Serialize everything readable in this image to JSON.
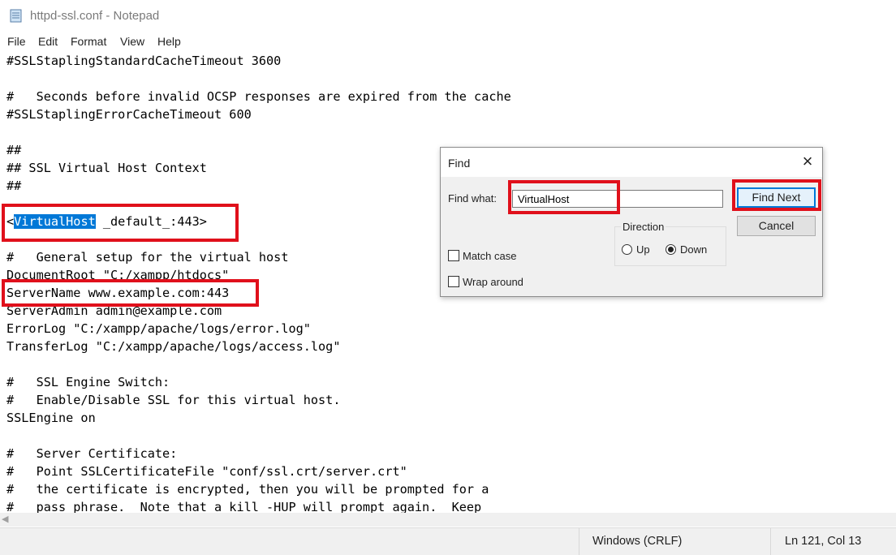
{
  "window": {
    "title": "httpd-ssl.conf - Notepad"
  },
  "menu": [
    "File",
    "Edit",
    "Format",
    "View",
    "Help"
  ],
  "editor": {
    "lines": [
      "#SSLStaplingStandardCacheTimeout 3600",
      "",
      "#   Seconds before invalid OCSP responses are expired from the cache",
      "#SSLStaplingErrorCacheTimeout 600",
      "",
      "##",
      "## SSL Virtual Host Context",
      "##",
      "",
      "",
      "#   General setup for the virtual host",
      "DocumentRoot \"C:/xampp/htdocs\"",
      "ServerName www.example.com:443",
      "ServerAdmin admin@example.com",
      "ErrorLog \"C:/xampp/apache/logs/error.log\"",
      "TransferLog \"C:/xampp/apache/logs/access.log\"",
      "",
      "#   SSL Engine Switch:",
      "#   Enable/Disable SSL for this virtual host.",
      "SSLEngine on",
      "",
      "#   Server Certificate:",
      "#   Point SSLCertificateFile \"conf/ssl.crt/server.crt\"",
      "#   the certificate is encrypted, then you will be prompted for a",
      "#   pass phrase.  Note that a kill -HUP will prompt again.  Keep"
    ],
    "vhost_prefix": "<",
    "vhost_selected": "VirtualHost",
    "vhost_suffix": " _default_:443>"
  },
  "status": {
    "line_ending": "Windows (CRLF)",
    "position": "Ln 121, Col 13"
  },
  "find_dialog": {
    "title": "Find",
    "find_what_label": "Find what:",
    "find_what_value": "VirtualHost",
    "find_next_label": "Find Next",
    "cancel_label": "Cancel",
    "direction_label": "Direction",
    "up_label": "Up",
    "down_label": "Down",
    "direction_selected": "Down",
    "match_case_label": "Match case",
    "match_case_checked": false,
    "wrap_around_label": "Wrap around",
    "wrap_around_checked": false
  },
  "colors": {
    "highlight_box": "#e0101b",
    "selection": "#0078d7"
  }
}
